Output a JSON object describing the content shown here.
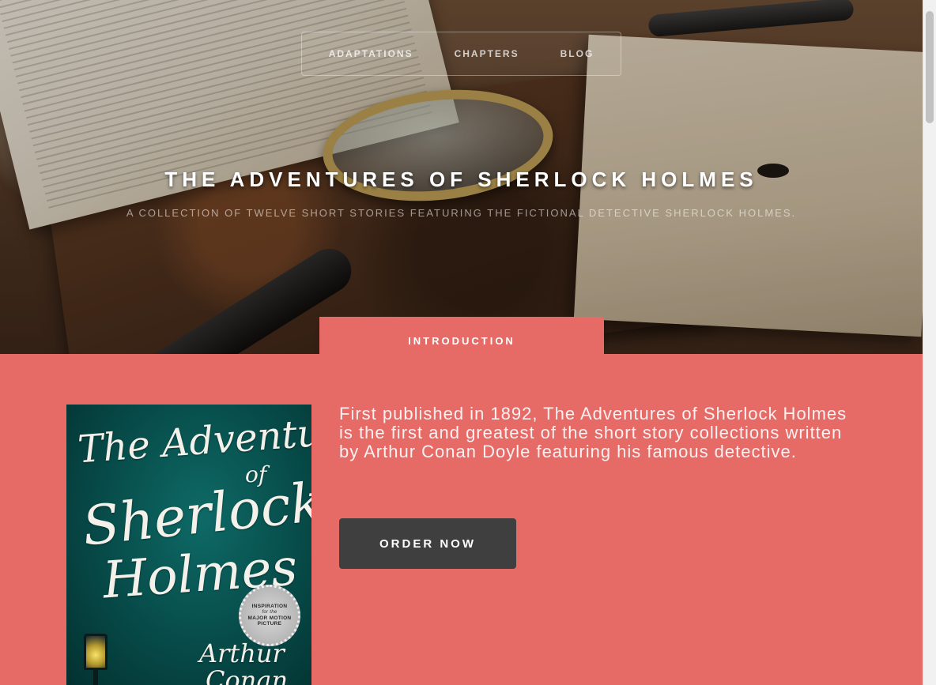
{
  "nav": {
    "items": [
      "ADAPTATIONS",
      "CHAPTERS",
      "BLOG"
    ]
  },
  "hero": {
    "title": "THE ADVENTURES OF SHERLOCK HOLMES",
    "subtitle": "A COLLECTION OF TWELVE SHORT STORIES FEATURING THE FICTIONAL DETECTIVE SHERLOCK HOLMES."
  },
  "intro": {
    "tab_label": "INTRODUCTION",
    "text": "First published in 1892, The Adventures of Sherlock Holmes is the first and greatest of the short story collections written by Arthur Conan Doyle featuring his famous detective.",
    "button_label": "ORDER NOW"
  },
  "cover": {
    "title_line1": "The Adventures",
    "title_line2": "of",
    "title_line3": "Sherlock",
    "title_line4": "Holmes",
    "badge_line1": "INSPIRATION",
    "badge_line2": "for the",
    "badge_line3": "MAJOR MOTION",
    "badge_line4": "PICTURE",
    "author_line1": "Arthur",
    "author_line2": "Conan"
  },
  "colors": {
    "accent": "#e66b67",
    "button": "#3f3f3f",
    "cover": "#064745"
  }
}
